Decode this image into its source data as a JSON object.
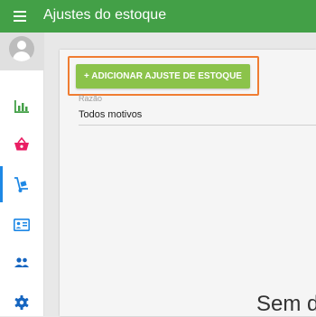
{
  "header": {
    "title": "Ajustes do estoque",
    "background": "#43a047"
  },
  "sidebar": {
    "items": [
      {
        "icon": "bar-chart-icon",
        "color": "#43a047"
      },
      {
        "icon": "basket-icon",
        "color": "#e91e63"
      },
      {
        "icon": "hand-truck-icon",
        "color": "#1e88e5",
        "active": true
      },
      {
        "icon": "id-card-icon",
        "color": "#1e88e5"
      },
      {
        "icon": "people-icon",
        "color": "#1565c0"
      },
      {
        "icon": "gear-icon",
        "color": "#1565c0"
      }
    ]
  },
  "main": {
    "add_button_label": "+ ADICIONAR AJUSTE DE ESTOQUE",
    "add_button_color": "#8bc34a",
    "highlight_color": "#f07d32",
    "reason_field": {
      "label": "Razão",
      "value": "Todos motivos"
    },
    "empty_state_text": "Sem d"
  }
}
